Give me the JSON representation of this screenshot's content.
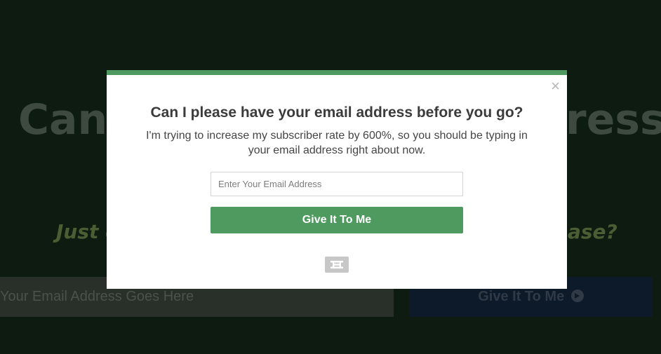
{
  "background": {
    "headline_left": "Can",
    "headline_right": "ress",
    "subheading_left": "Just e",
    "subheading_right": "ease?",
    "email_placeholder": "Your Email Address Goes Here",
    "button_label": "Give It To Me"
  },
  "modal": {
    "close_symbol": "×",
    "title": "Can I please have your email address before you go?",
    "description": "I'm trying to increase my subscriber rate by 600%, so you should be typing in your email address right about now.",
    "email_placeholder": "Enter Your Email Address",
    "submit_label": "Give It To Me",
    "accent_color": "#4f9a5e"
  },
  "icons": {
    "close": "close-icon",
    "logo": "brand-logo-icon",
    "arrow": "arrow-circle-right-icon"
  }
}
